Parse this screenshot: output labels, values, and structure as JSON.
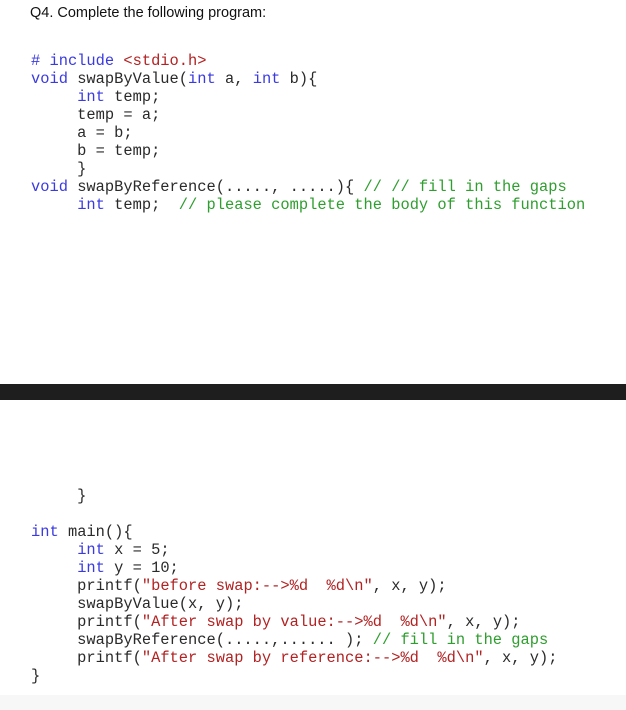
{
  "question_title": "Q4. Complete the following program:",
  "code_top": [
    [
      {
        "t": "# include ",
        "c": "pp"
      },
      {
        "t": "<stdio.h>",
        "c": "str"
      }
    ],
    [
      {
        "t": "void",
        "c": "kw"
      },
      {
        "t": " swapByValue(",
        "c": ""
      },
      {
        "t": "int",
        "c": "kw"
      },
      {
        "t": " a, ",
        "c": ""
      },
      {
        "t": "int",
        "c": "kw"
      },
      {
        "t": " b){",
        "c": ""
      }
    ],
    [
      {
        "t": "     ",
        "c": ""
      },
      {
        "t": "int",
        "c": "kw"
      },
      {
        "t": " temp;",
        "c": ""
      }
    ],
    [
      {
        "t": "     temp = a;",
        "c": ""
      }
    ],
    [
      {
        "t": "     a = b;",
        "c": ""
      }
    ],
    [
      {
        "t": "     b = temp;",
        "c": ""
      }
    ],
    [
      {
        "t": "     }",
        "c": ""
      }
    ],
    [
      {
        "t": "void",
        "c": "kw"
      },
      {
        "t": " swapByReference(....., .....){ ",
        "c": ""
      },
      {
        "t": "// // fill in the gaps",
        "c": "cm"
      }
    ],
    [
      {
        "t": "     ",
        "c": ""
      },
      {
        "t": "int",
        "c": "kw"
      },
      {
        "t": " temp;  ",
        "c": ""
      },
      {
        "t": "// please complete the body of this function",
        "c": "cm"
      }
    ]
  ],
  "code_bottom": [
    [
      {
        "t": "     }",
        "c": ""
      }
    ],
    [
      {
        "t": "",
        "c": ""
      }
    ],
    [
      {
        "t": "int",
        "c": "kw"
      },
      {
        "t": " main(){",
        "c": ""
      }
    ],
    [
      {
        "t": "     ",
        "c": ""
      },
      {
        "t": "int",
        "c": "kw"
      },
      {
        "t": " x = 5;",
        "c": ""
      }
    ],
    [
      {
        "t": "     ",
        "c": ""
      },
      {
        "t": "int",
        "c": "kw"
      },
      {
        "t": " y = 10;",
        "c": ""
      }
    ],
    [
      {
        "t": "     printf(",
        "c": ""
      },
      {
        "t": "\"before swap:-->%d  %d\\n\"",
        "c": "str"
      },
      {
        "t": ", x, y);",
        "c": ""
      }
    ],
    [
      {
        "t": "     swapByValue(x, y);",
        "c": ""
      }
    ],
    [
      {
        "t": "     printf(",
        "c": ""
      },
      {
        "t": "\"After swap by value:-->%d  %d\\n\"",
        "c": "str"
      },
      {
        "t": ", x, y);",
        "c": ""
      }
    ],
    [
      {
        "t": "     swapByReference(.....,...... ); ",
        "c": ""
      },
      {
        "t": "// fill in the gaps",
        "c": "cm"
      }
    ],
    [
      {
        "t": "     printf(",
        "c": ""
      },
      {
        "t": "\"After swap by reference:-->%d  %d\\n\"",
        "c": "str"
      },
      {
        "t": ", x, y);",
        "c": ""
      }
    ],
    [
      {
        "t": "}",
        "c": ""
      }
    ]
  ],
  "colors": {
    "keyword": "#3a3ae0",
    "string": "#b22222",
    "comment": "#2e9e2e",
    "text": "#2a2a2a",
    "divider": "#1e1e1e"
  }
}
